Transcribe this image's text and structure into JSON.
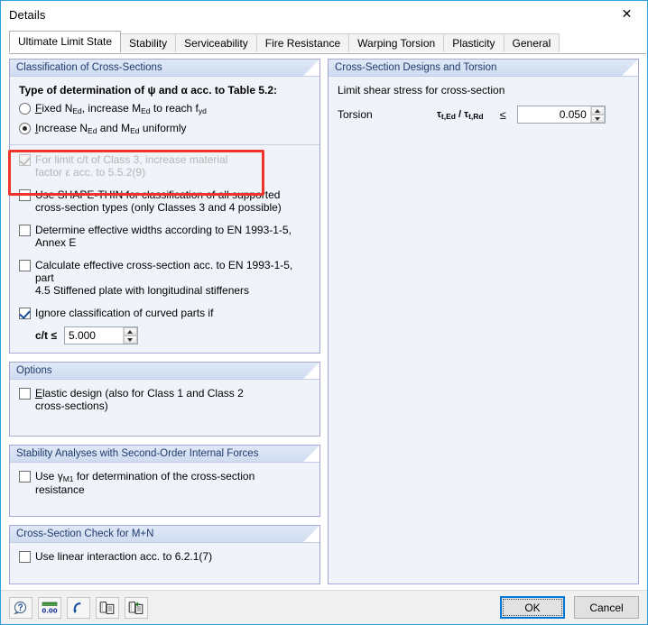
{
  "window": {
    "title": "Details",
    "close_icon": "close-icon"
  },
  "tabs": [
    {
      "label": "Ultimate Limit State",
      "active": true
    },
    {
      "label": "Stability",
      "active": false
    },
    {
      "label": "Serviceability",
      "active": false
    },
    {
      "label": "Fire Resistance",
      "active": false
    },
    {
      "label": "Warping Torsion",
      "active": false
    },
    {
      "label": "Plasticity",
      "active": false
    },
    {
      "label": "General",
      "active": false
    }
  ],
  "left": {
    "classification": {
      "header": "Classification of Cross-Sections",
      "determination_label": "Type of determination of ψ and α acc. to Table 5.2:",
      "radio_fixed": {
        "accel": "F",
        "rest": "ixed N",
        "sub1": "Ed",
        "mid": ", increase M",
        "sub2": "Ed",
        "tail": " to reach f",
        "sub3": "yd",
        "checked": false
      },
      "radio_increase": {
        "accel": "I",
        "rest": "ncrease N",
        "sub1": "Ed",
        "mid": " and M",
        "sub2": "Ed",
        "tail": " uniformly",
        "checked": true
      },
      "cb_limit_ct": {
        "line1": "For limit c/t of Class 3, increase material",
        "line2": "factor ε acc. to 5.5.2(9)",
        "checked": true,
        "disabled": true,
        "highlighted": true
      },
      "cb_shape_thin": {
        "line1": "Use SHAPE-THIN for classification of all supported",
        "line2": "cross-section types (only Classes 3 and 4 possible)",
        "checked": false
      },
      "cb_effective_widths": {
        "line1": "Determine effective widths according to EN 1993-1-5, Annex E",
        "checked": false
      },
      "cb_effective_cs": {
        "line1": "Calculate effective cross-section acc. to EN 1993-1-5, part",
        "line2": "4.5 Stiffened plate with longitudinal stiffeners",
        "checked": false
      },
      "cb_ignore_curved": {
        "line1": "Ignore classification of curved parts if",
        "checked": true
      },
      "ct_label": "c/t ≤",
      "ct_value": "5.000"
    },
    "options": {
      "header": "Options",
      "cb_elastic": {
        "accel": "E",
        "line1_rest": "lastic design (also for Class 1 and Class 2",
        "line2": "cross-sections)",
        "checked": false
      }
    },
    "stability": {
      "header": "Stability Analyses with Second-Order Internal Forces",
      "cb_gamma": {
        "pre": "Use ",
        "gamma": "γ",
        "sub": "M1",
        "line1_rest": " for determination of the cross-section",
        "line2": "resistance",
        "checked": false
      }
    },
    "check_mn": {
      "header": "Cross-Section Check for M+N",
      "cb_linear": {
        "line1": "Use linear interaction acc. to 6.2.1(7)",
        "checked": false
      }
    }
  },
  "right": {
    "torsion": {
      "header": "Cross-Section Designs and Torsion",
      "limit_label": "Limit shear stress for cross-section",
      "row_label": "Torsion",
      "ratio_tau": "τ",
      "ratio_sub1": "t,Ed",
      "ratio_slash": " / ",
      "ratio_tau2": "τ",
      "ratio_sub2": "t,Rd",
      "operator": "≤",
      "value": "0.050"
    }
  },
  "footer": {
    "tools": [
      {
        "name": "help-icon",
        "glyph": "?"
      },
      {
        "name": "units-icon",
        "glyph": "0.00"
      },
      {
        "name": "undo-icon",
        "glyph": "↷"
      },
      {
        "name": "copy-icon",
        "glyph": "copy"
      },
      {
        "name": "paste-icon",
        "glyph": "paste"
      }
    ],
    "ok_label": "OK",
    "cancel_label": "Cancel"
  },
  "colors": {
    "accent": "#2e9fdd",
    "group_border": "#a6a6d9",
    "group_header_text": "#1f3b6e",
    "highlight": "#f0342c",
    "focus": "#0078d7"
  }
}
